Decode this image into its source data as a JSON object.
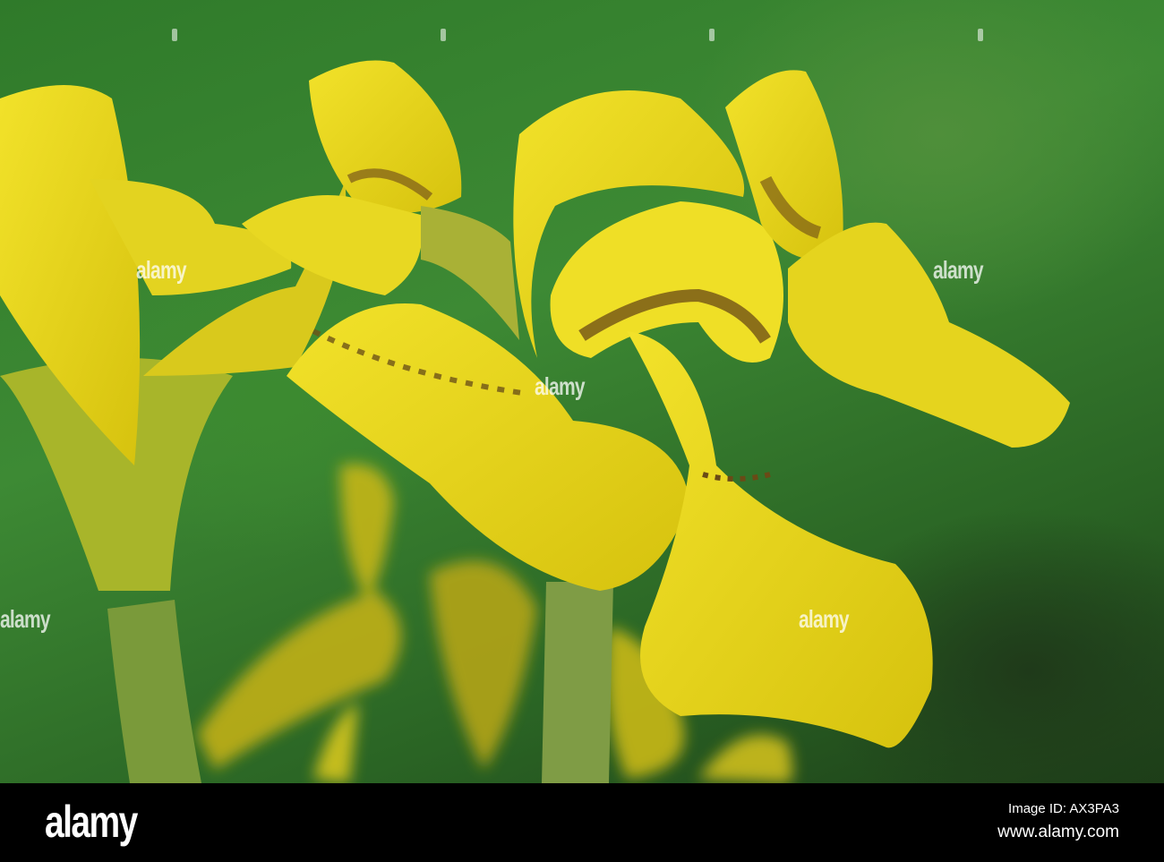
{
  "photo": {
    "subject": "yellow iris flowers",
    "watermark_text": "alamy"
  },
  "footer": {
    "logo": "alamy",
    "image_id": "Image ID: AX3PA3",
    "url": "www.alamy.com"
  },
  "colors": {
    "petal": "#e6d619",
    "background": "#2f7a2a",
    "bar": "#000000"
  }
}
